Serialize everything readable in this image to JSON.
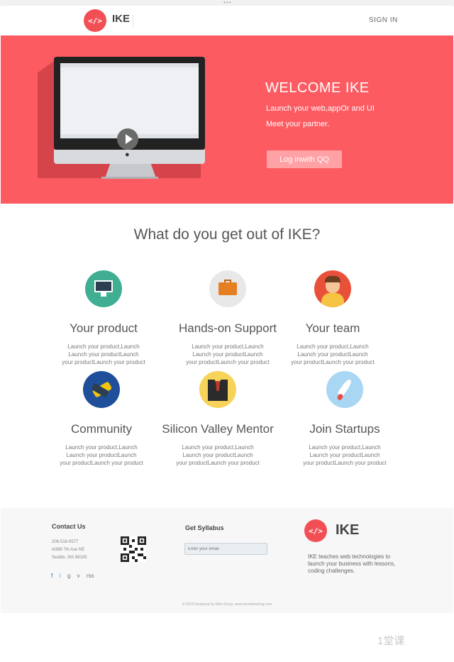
{
  "header": {
    "logo_symbol": "</>",
    "logo_text": "IKE",
    "signin_label": "SIGN IN"
  },
  "hero": {
    "title": "WELCOME IKE",
    "line1": "Launch your web,appOr and UI",
    "line2": "Meet your partner.",
    "button_label": "Log inwith QQ",
    "bg_color": "#fc5b61"
  },
  "features": {
    "title": "What do you get out of IKE?",
    "items": [
      {
        "title": "Your product",
        "desc1": "Launch your product,Launch",
        "desc2": "Launch your productLaunch",
        "desc3": "your productLaunch your product",
        "icon": "monitor-icon",
        "color": "#3fae92"
      },
      {
        "title": "Hands-on Support",
        "desc1": "Launch your product,Launch",
        "desc2": "Launch your productLaunch",
        "desc3": "your productLaunch your product",
        "icon": "briefcase-icon",
        "color": "#e8e8e8"
      },
      {
        "title": "Your team",
        "desc1": "Launch your product,Launch",
        "desc2": "Launch your productLaunch",
        "desc3": "your productLaunch your product",
        "icon": "person-icon",
        "color": "#e8503a"
      },
      {
        "title": "Community",
        "desc1": "Launch your product,Launch",
        "desc2": "Launch your productLaunch",
        "desc3": "your productLaunch your product",
        "icon": "handshake-icon",
        "color": "#1f4f9a"
      },
      {
        "title": "Silicon Valley Mentor",
        "desc1": "Launch your product,Launch",
        "desc2": "Launch your productLaunch",
        "desc3": "your productLaunch your product",
        "icon": "suit-icon",
        "color": "#f7d35a"
      },
      {
        "title": "Join Startups",
        "desc1": "Launch your product,Launch",
        "desc2": "Launch your productLaunch",
        "desc3": "your productLaunch your product",
        "icon": "rocket-icon",
        "color": "#a9d6f2"
      }
    ]
  },
  "footer": {
    "contact_title": "Contact Us",
    "phone": "206-518-9577",
    "address1": "l4388 7th Ave NE",
    "address2": "Seattle, WA 98105",
    "social": [
      "f",
      "t",
      "g",
      "v",
      "rss"
    ],
    "syllabus_title": "Get Syllabus",
    "email_placeholder": "Enter your email",
    "logo_symbol": "</>",
    "logo_text": "IKE",
    "tagline": "IKE teaches web technologies to launch your business with lessons, coding challenges.",
    "copyright": "© 2014 Designed by Ellen Dong. www.iamellendong.com"
  },
  "watermark": "1堂课"
}
